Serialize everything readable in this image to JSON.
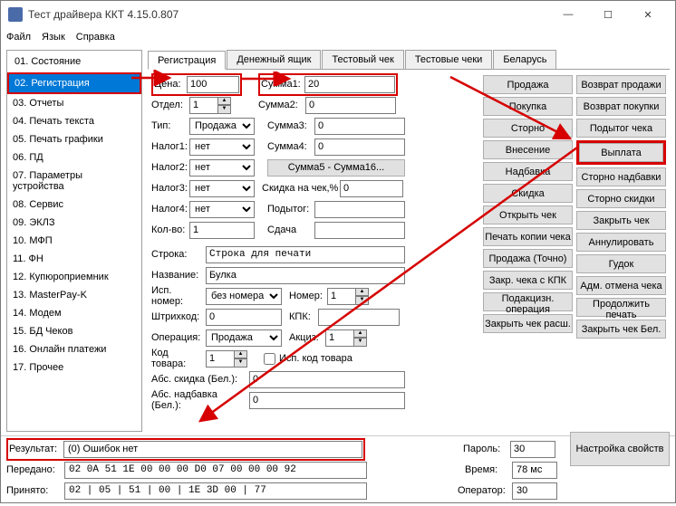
{
  "window": {
    "title": "Тест драйвера ККТ 4.15.0.807"
  },
  "menu": {
    "file": "Файл",
    "lang": "Язык",
    "help": "Справка"
  },
  "sidebar": {
    "items": [
      {
        "label": "01. Состояние"
      },
      {
        "label": "02. Регистрация"
      },
      {
        "label": "03. Отчеты"
      },
      {
        "label": "04. Печать текста"
      },
      {
        "label": "05. Печать графики"
      },
      {
        "label": "06. ПД"
      },
      {
        "label": "07. Параметры устройства"
      },
      {
        "label": "08. Сервис"
      },
      {
        "label": "09. ЭКЛЗ"
      },
      {
        "label": "10. МФП"
      },
      {
        "label": "11. ФН"
      },
      {
        "label": "12. Купюроприемник"
      },
      {
        "label": "13. MasterPay-K"
      },
      {
        "label": "14. Модем"
      },
      {
        "label": "15. БД Чеков"
      },
      {
        "label": "16. Онлайн платежи"
      },
      {
        "label": "17. Прочее"
      }
    ]
  },
  "tabs": [
    {
      "label": "Регистрация"
    },
    {
      "label": "Денежный ящик"
    },
    {
      "label": "Тестовый чек"
    },
    {
      "label": "Тестовые чеки"
    },
    {
      "label": "Беларусь"
    }
  ],
  "form": {
    "price_lbl": "Цена:",
    "price": "100",
    "dept_lbl": "Отдел:",
    "dept": "1",
    "type_lbl": "Тип:",
    "type": "Продажа",
    "tax1_lbl": "Налог1:",
    "tax1": "нет",
    "tax2_lbl": "Налог2:",
    "tax2": "нет",
    "tax3_lbl": "Налог3:",
    "tax3": "нет",
    "tax4_lbl": "Налог4:",
    "tax4": "нет",
    "qty_lbl": "Кол-во:",
    "qty": "1",
    "sum1_lbl": "Сумма1:",
    "sum1": "20",
    "sum2_lbl": "Сумма2:",
    "sum2": "0",
    "sum3_lbl": "Сумма3:",
    "sum3": "0",
    "sum4_lbl": "Сумма4:",
    "sum4": "0",
    "sum516_btn": "Сумма5 - Сумма16...",
    "disc_lbl": "Скидка на чек,%",
    "disc": "0",
    "subtot_lbl": "Подытог:",
    "change_lbl": "Сдача",
    "line_lbl": "Строка:",
    "line": "Строка для печати",
    "name_lbl": "Название:",
    "name": "Булка",
    "execnum_lbl": "Исп. номер:",
    "execnum": "без номера",
    "num_lbl": "Номер:",
    "num": "1",
    "barcode_lbl": "Штрихкод:",
    "barcode": "0",
    "kpk_lbl": "КПК:",
    "kpk": "",
    "oper_lbl": "Операция:",
    "oper": "Продажа",
    "excise_lbl": "Акциз:",
    "excise": "1",
    "gcode_lbl": "Код товара:",
    "gcode": "1",
    "usegcode": "Исп. код товара",
    "absdisc_lbl": "Абс. скидка (Бел.):",
    "absdisc": "0",
    "abscharge_lbl": "Абс. надбавка (Бел.):",
    "abscharge": "0"
  },
  "buttons": {
    "c1": [
      "Продажа",
      "Покупка",
      "Сторно",
      "Внесение",
      "Надбавка",
      "Скидка",
      "Открыть чек",
      "Печать копии чека",
      "Продажа (Точно)",
      "Закр. чека с КПК",
      "Подакцизн. операция",
      "Закрыть чек расш."
    ],
    "c2": [
      "Возврат продажи",
      "Возврат покупки",
      "Подытог чека",
      "Выплата",
      "Сторно надбавки",
      "Сторно скидки",
      "Закрыть чек",
      "Аннулировать",
      "Гудок",
      "Адм. отмена чека",
      "Продолжить печать",
      "Закрыть чек Бел."
    ]
  },
  "bottom": {
    "result_lbl": "Результат:",
    "result": "(0) Ошибок нет",
    "sent_lbl": "Передано:",
    "sent": "02 0A 51 1E 00 00 00 D0 07 00 00 00 92",
    "recv_lbl": "Принято:",
    "recv": "02 | 05 | 51 | 00 | 1E 3D 00 | 77",
    "pass_lbl": "Пароль:",
    "pass": "30",
    "time_lbl": "Время:",
    "time": "78 мс",
    "oper_lbl": "Оператор:",
    "oper": "30",
    "settings": "Настройка свойств"
  }
}
